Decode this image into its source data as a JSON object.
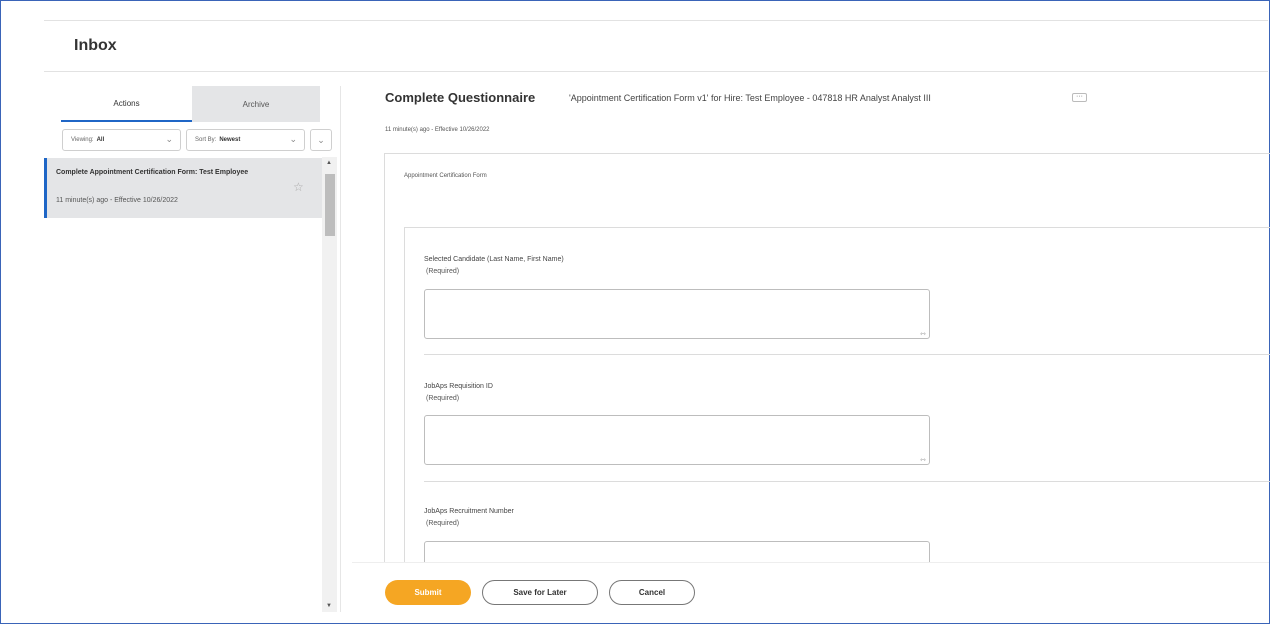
{
  "page": {
    "title": "Inbox"
  },
  "tabs": [
    {
      "label": "Actions"
    },
    {
      "label": "Archive"
    }
  ],
  "filters": {
    "viewing_label": "Viewing:",
    "viewing_value": "All",
    "sort_label": "Sort By:",
    "sort_value": "Newest"
  },
  "inbox_items": [
    {
      "title": "Complete Appointment Certification Form: Test Employee",
      "meta": "11 minute(s) ago - Effective 10/26/2022"
    }
  ],
  "task": {
    "title": "Complete Questionnaire",
    "subtitle": "'Appointment Certification Form v1' for Hire: Test Employee - 047818 HR Analyst Analyst III",
    "more_glyph": "···",
    "meta": "11 minute(s) ago - Effective 10/26/2022"
  },
  "form": {
    "name": "Appointment Certification Form",
    "questions": [
      {
        "label": "Selected Candidate (Last Name, First Name)",
        "required": "(Required)",
        "value": ""
      },
      {
        "label": "JobAps Requisition ID",
        "required": "(Required)",
        "value": ""
      },
      {
        "label": "JobAps Recruitment Number",
        "required": "(Required)",
        "value": ""
      }
    ]
  },
  "buttons": {
    "submit": "Submit",
    "save_for_later": "Save for Later",
    "cancel": "Cancel"
  },
  "colors": {
    "accent_blue": "#1f66c6",
    "submit_orange": "#f5a623"
  },
  "icons": {
    "favorite": "star-outline-icon",
    "dropdown": "chevron-down-icon"
  }
}
